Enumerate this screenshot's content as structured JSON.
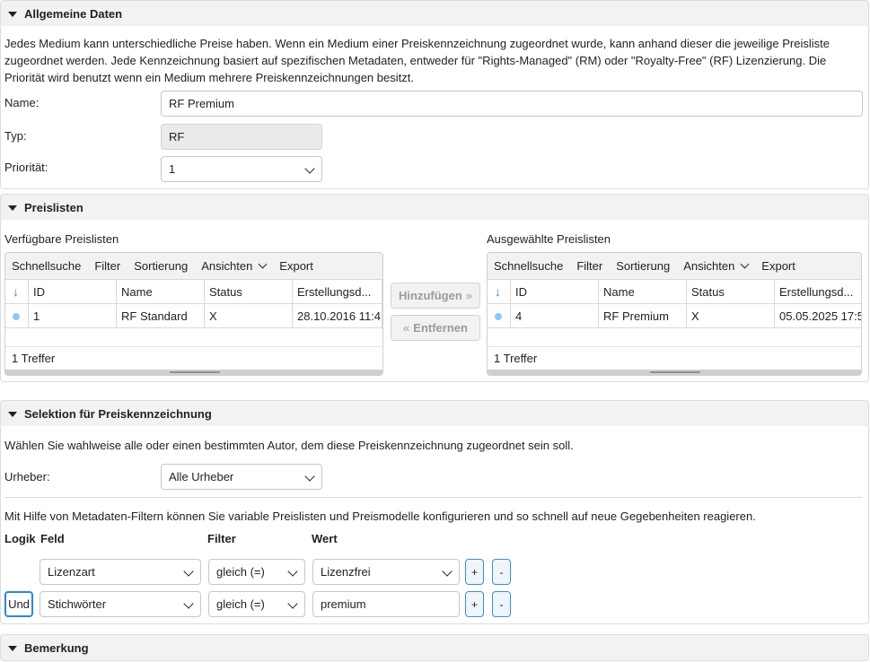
{
  "general": {
    "title": "Allgemeine Daten",
    "description": "Jedes Medium kann unterschiedliche Preise haben. Wenn ein Medium einer Preiskennzeichnung zugeordnet wurde, kann anhand dieser die jeweilige Preisliste zugeordnet werden. Jede Kennzeichnung basiert auf spezifischen Metadaten, entweder für \"Rights-Managed\" (RM) oder \"Royalty-Free\" (RF) Lizenzierung. Die Priorität wird benutzt wenn ein Medium mehrere Preiskennzeichnungen besitzt.",
    "name_label": "Name:",
    "name_value": "RF Premium",
    "type_label": "Typ:",
    "type_value": "RF",
    "priority_label": "Priorität:",
    "priority_value": "1"
  },
  "pricelists": {
    "title": "Preislisten",
    "available_label": "Verfügbare Preislisten",
    "selected_label": "Ausgewählte Preislisten",
    "toolbar": {
      "quicksearch": "Schnellsuche",
      "filter": "Filter",
      "sort": "Sortierung",
      "views": "Ansichten",
      "export": "Export"
    },
    "columns": [
      "ID",
      "Name",
      "Status",
      "Erstellungsd..."
    ],
    "available_rows": [
      {
        "id": "1",
        "name": "RF Standard",
        "status": "X",
        "created": "28.10.2016 11:4"
      }
    ],
    "selected_rows": [
      {
        "id": "4",
        "name": "RF Premium",
        "status": "X",
        "created": "05.05.2025 17:5"
      }
    ],
    "available_count": "1 Treffer",
    "selected_count": "1 Treffer",
    "add_button": "Hinzufügen",
    "remove_button": "Entfernen"
  },
  "selection": {
    "title": "Selektion für Preiskennzeichnung",
    "author_description": "Wählen Sie wahlweise alle oder einen bestimmten Autor, dem diese Preiskennzeichnung zugeordnet sein soll.",
    "author_label": "Urheber:",
    "author_value": "Alle Urheber",
    "filter_description": "Mit Hilfe von Metadaten-Filtern können Sie variable Preislisten und Preismodelle konfigurieren und so schnell auf neue Gegebenheiten reagieren.",
    "headers": {
      "logic": "Logik",
      "field": "Feld",
      "filter": "Filter",
      "value": "Wert"
    },
    "rows": [
      {
        "logic": "",
        "field": "Lizenzart",
        "filter": "gleich (=)",
        "value": "Lizenzfrei"
      },
      {
        "logic": "Und",
        "field": "Stichwörter",
        "filter": "gleich (=)",
        "value": "premium"
      }
    ],
    "plus": "+",
    "minus": "-"
  },
  "remarks": {
    "title": "Bemerkung"
  }
}
